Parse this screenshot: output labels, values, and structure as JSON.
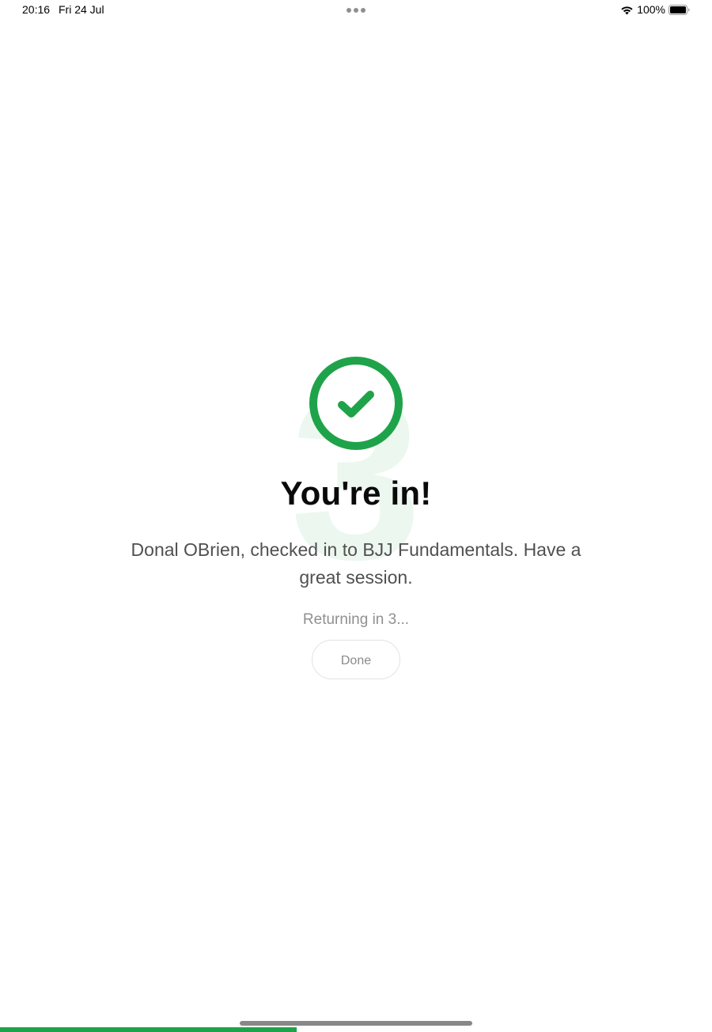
{
  "status_bar": {
    "time": "20:16",
    "date": "Fri 24 Jul",
    "battery_percent": "100%"
  },
  "checkin": {
    "countdown_number": "3",
    "headline": "You're in!",
    "message": "Donal OBrien, checked in to BJJ Fundamentals. Have a great session.",
    "returning_text": "Returning in 3...",
    "done_label": "Done"
  },
  "progress": {
    "fraction": 0.417
  },
  "colors": {
    "accent_green": "#1fa34a",
    "countdown_bg": "#e9f6ed"
  },
  "icons": {
    "success": "checkmark-circle-icon",
    "wifi": "wifi-icon",
    "battery": "battery-icon",
    "multitask": "more-dots-icon"
  }
}
